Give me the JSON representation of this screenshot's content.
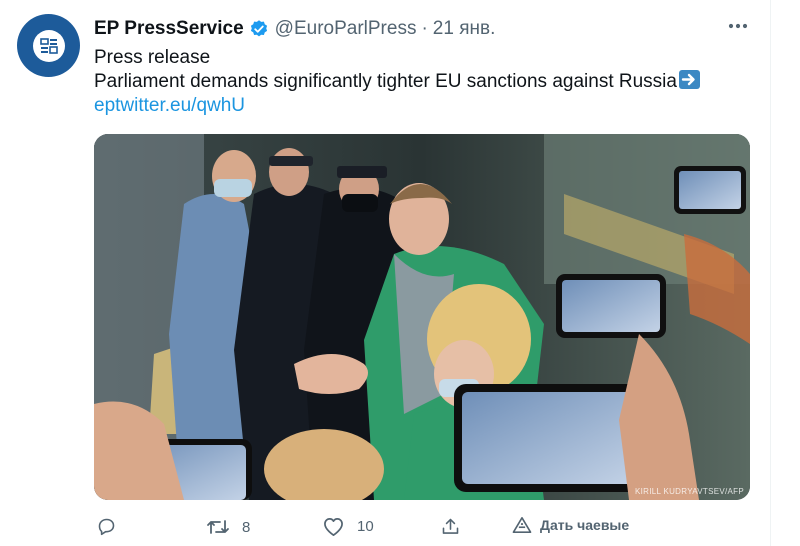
{
  "tweet": {
    "author": {
      "name": "EP PressService",
      "handle": "@EuroParlPress",
      "separator": "·",
      "date": "21 янв."
    },
    "text_lines": [
      "Press release",
      "Parliament demands significantly tighter EU sanctions against Russia"
    ],
    "link": "eptwitter.eu/qwhU",
    "media": {
      "credit": "KIRILL KUDRYAVTSEV/AFP"
    },
    "actions": {
      "retweets": "8",
      "likes": "10",
      "tip_label": "Дать чаевые"
    }
  },
  "colors": {
    "text": "#0f1419",
    "secondary": "#536471",
    "link": "#1b95e0",
    "verified": "#1d9bf0",
    "avatar": "#1d5b9a"
  },
  "icons": [
    "verified-badge-icon",
    "more-icon",
    "reply-icon",
    "retweet-icon",
    "like-icon",
    "share-icon",
    "tip-icon",
    "right-arrow-emoji"
  ]
}
